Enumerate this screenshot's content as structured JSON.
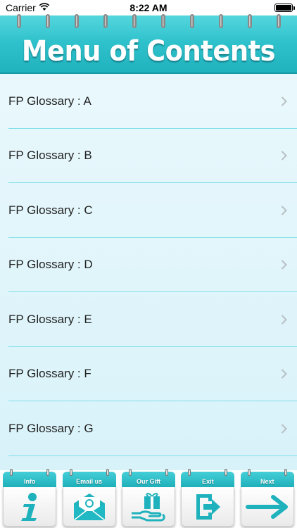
{
  "status_bar": {
    "carrier": "Carrier",
    "time": "8:22 AM"
  },
  "header": {
    "title": "Menu of Contents"
  },
  "menu": {
    "items": [
      {
        "label": "FP Glossary : A"
      },
      {
        "label": "FP Glossary : B"
      },
      {
        "label": "FP Glossary : C"
      },
      {
        "label": "FP Glossary : D"
      },
      {
        "label": "FP Glossary : E"
      },
      {
        "label": "FP Glossary : F"
      },
      {
        "label": "FP Glossary : G"
      }
    ]
  },
  "bottom_bar": {
    "buttons": [
      {
        "label": "Info",
        "icon": "info-icon"
      },
      {
        "label": "Email us",
        "icon": "email-icon"
      },
      {
        "label": "Our Gift",
        "icon": "gift-icon"
      },
      {
        "label": "Exit",
        "icon": "exit-icon"
      },
      {
        "label": "Next",
        "icon": "arrow-right-icon"
      }
    ]
  },
  "colors": {
    "accent": "#2fc2cc",
    "list_background": "#e3f6fb",
    "separator": "#7fe0ea"
  }
}
